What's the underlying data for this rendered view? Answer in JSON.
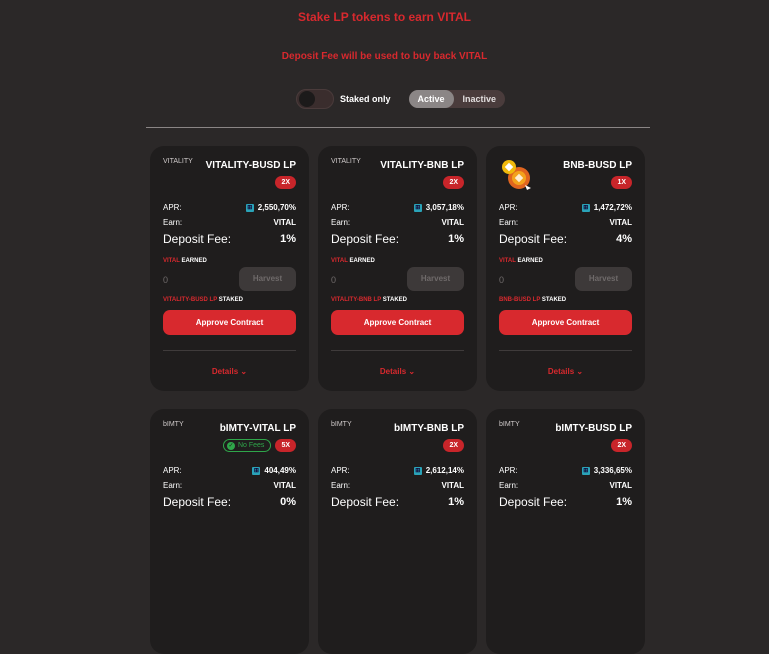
{
  "header": {
    "title": "Stake LP tokens to earn VITAL",
    "subtitle": "Deposit Fee will be used to buy back VITAL"
  },
  "controls": {
    "staked_only_label": "Staked only",
    "staked_only_on": false,
    "tabs": [
      "Active",
      "Inactive"
    ],
    "active_tab": "Active"
  },
  "labels": {
    "apr": "APR:",
    "earn": "Earn:",
    "deposit_fee": "Deposit Fee:",
    "earned_token": "VITAL",
    "earned_suffix": "EARNED",
    "staked_suffix": "STAKED",
    "harvest": "Harvest",
    "approve": "Approve Contract",
    "details": "Details",
    "no_fees": "No Fees"
  },
  "farms": [
    {
      "logo_text": "VITALITY",
      "title": "VITALITY-BUSD LP",
      "multiplier": "2X",
      "apr": "2,550,70%",
      "earn": "VITAL",
      "deposit_fee": "1%",
      "earned": "0",
      "staked_token": "VITALITY-BUSD LP"
    },
    {
      "logo_text": "VITALITY",
      "title": "VITALITY-BNB LP",
      "multiplier": "2X",
      "apr": "3,057,18%",
      "earn": "VITAL",
      "deposit_fee": "1%",
      "earned": "0",
      "staked_token": "VITALITY-BNB LP"
    },
    {
      "logo_text": "",
      "title": "BNB-BUSD LP",
      "multiplier": "1X",
      "apr": "1,472,72%",
      "earn": "VITAL",
      "deposit_fee": "4%",
      "earned": "0",
      "staked_token": "BNB-BUSD LP"
    },
    {
      "logo_text": "bIMTY",
      "title": "bIMTY-VITAL LP",
      "multiplier": "5X",
      "apr": "404,49%",
      "earn": "VITAL",
      "deposit_fee": "0%",
      "no_fees": true
    },
    {
      "logo_text": "bIMTY",
      "title": "bIMTY-BNB LP",
      "multiplier": "2X",
      "apr": "2,612,14%",
      "earn": "VITAL",
      "deposit_fee": "1%"
    },
    {
      "logo_text": "bIMTY",
      "title": "bIMTY-BUSD LP",
      "multiplier": "2X",
      "apr": "3,336,65%",
      "earn": "VITAL",
      "deposit_fee": "1%"
    }
  ],
  "colors": {
    "accent": "#d8292e",
    "background": "#2b2828",
    "card": "#1f1d1d",
    "no_fees": "#2fa64a"
  }
}
